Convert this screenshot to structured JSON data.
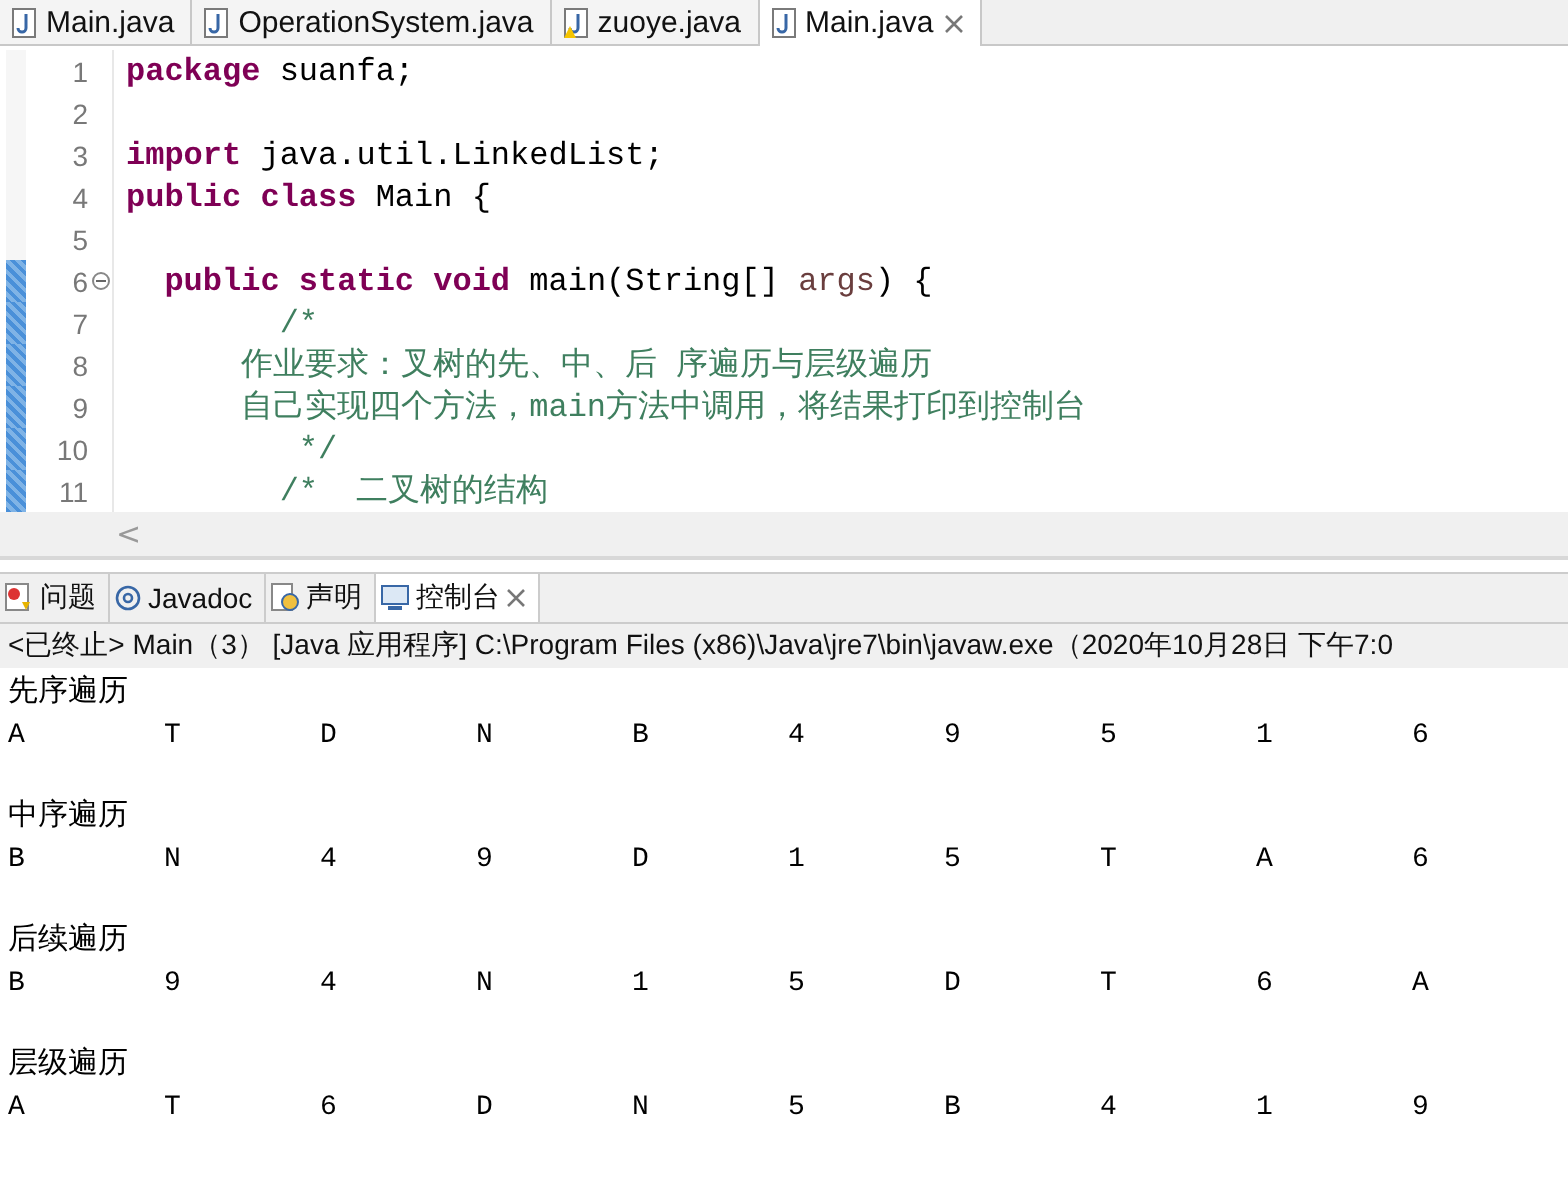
{
  "editor_tabs": [
    {
      "label": "Main.java",
      "selected": false,
      "warning": false,
      "closable": false
    },
    {
      "label": "OperationSystem.java",
      "selected": false,
      "warning": false,
      "closable": false
    },
    {
      "label": "zuoye.java",
      "selected": false,
      "warning": true,
      "closable": false
    },
    {
      "label": "Main.java",
      "selected": true,
      "warning": false,
      "closable": true
    }
  ],
  "code_lines": [
    {
      "number": "1",
      "changed": false,
      "foldable": false,
      "tokens": [
        {
          "kind": "keyword",
          "text": "package"
        },
        {
          "kind": "plain",
          "text": " suanfa;"
        }
      ]
    },
    {
      "number": "2",
      "changed": false,
      "foldable": false
    },
    {
      "number": "3",
      "changed": false,
      "foldable": false,
      "tokens": [
        {
          "kind": "keyword",
          "text": "import"
        },
        {
          "kind": "plain",
          "text": " java.util.LinkedList;"
        }
      ]
    },
    {
      "number": "4",
      "changed": false,
      "foldable": false,
      "tokens": [
        {
          "kind": "keyword",
          "text": "public class"
        },
        {
          "kind": "plain",
          "text": " Main {"
        }
      ]
    },
    {
      "number": "5",
      "changed": false,
      "foldable": false
    },
    {
      "number": "6",
      "changed": true,
      "foldable": true,
      "tokens": [
        {
          "kind": "keyword",
          "text": "  public static void"
        },
        {
          "kind": "plain",
          "text": " main(String[] "
        },
        {
          "kind": "param",
          "text": "args"
        },
        {
          "kind": "plain",
          "text": ") {"
        }
      ]
    },
    {
      "number": "7",
      "changed": true,
      "foldable": false,
      "tokens": [
        {
          "kind": "comment",
          "text": "        /*"
        }
      ]
    },
    {
      "number": "8",
      "changed": true,
      "foldable": false,
      "tokens": [
        {
          "kind": "comment",
          "text": "      作业要求：叉树的先、中、后 序遍历与层级遍历"
        }
      ]
    },
    {
      "number": "9",
      "changed": true,
      "foldable": false,
      "tokens": [
        {
          "kind": "comment",
          "text": "      自己实现四个方法，main方法中调用，将结果打印到控制台"
        }
      ]
    },
    {
      "number": "10",
      "changed": true,
      "foldable": false,
      "tokens": [
        {
          "kind": "comment",
          "text": "         */"
        }
      ]
    },
    {
      "number": "11",
      "changed": true,
      "foldable": false,
      "tokens": [
        {
          "kind": "comment",
          "text": "        /*  二叉树的结构"
        }
      ]
    }
  ],
  "scroll_arrow": "<",
  "console_tabs": [
    {
      "label": "问题",
      "selected": false,
      "closable": false
    },
    {
      "label": "Javadoc",
      "selected": false,
      "closable": false
    },
    {
      "label": "声明",
      "selected": false,
      "closable": false
    },
    {
      "label": "控制台",
      "selected": true,
      "closable": true
    }
  ],
  "console_header": "<已终止> Main（3） [Java 应用程序] C:\\Program Files (x86)\\Java\\jre7\\bin\\javaw.exe（2020年10月28日 下午7:0",
  "output": [
    {
      "title": "先序遍历",
      "values": [
        "A",
        "T",
        "D",
        "N",
        "B",
        "4",
        "9",
        "5",
        "1",
        "6"
      ]
    },
    {
      "title": "中序遍历",
      "values": [
        "B",
        "N",
        "4",
        "9",
        "D",
        "1",
        "5",
        "T",
        "A",
        "6"
      ]
    },
    {
      "title": "后续遍历",
      "values": [
        "B",
        "9",
        "4",
        "N",
        "1",
        "5",
        "D",
        "T",
        "6",
        "A"
      ]
    },
    {
      "title": "层级遍历",
      "values": [
        "A",
        "T",
        "6",
        "D",
        "N",
        "5",
        "B",
        "4",
        "1",
        "9"
      ]
    }
  ]
}
